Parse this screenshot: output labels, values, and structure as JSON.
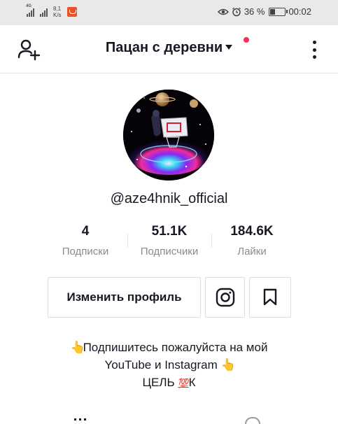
{
  "status_bar": {
    "signal1_tag": "4G",
    "net_speed_value": "8,1",
    "net_speed_unit": "K/s",
    "battery_percent": "36 %",
    "battery_level": 0.36,
    "time": "00:02"
  },
  "header": {
    "title": "Пацан с деревни",
    "notification_color": "#fe2c55"
  },
  "profile": {
    "username": "@aze4hnik_official",
    "avatar_icon": "space-basketball-hoop-avatar"
  },
  "stats": [
    {
      "value": "4",
      "label": "Подписки"
    },
    {
      "value": "51.1K",
      "label": "Подписчики"
    },
    {
      "value": "184.6K",
      "label": "Лайки"
    }
  ],
  "actions": {
    "edit_profile": "Изменить профиль",
    "instagram_icon": "instagram-icon",
    "bookmark_icon": "bookmark-icon"
  },
  "bio": {
    "line1_emoji": "👆",
    "line1": "Подпишитесь пожалуйста на мой",
    "line2": "YouTube и Instagram",
    "line2_emoji": "👆",
    "line3_prefix": "ЦЕЛЬ",
    "line3_emoji": "💯",
    "line3_suffix": "К"
  },
  "colors": {
    "accent": "#fe2c55",
    "text_primary": "#161823",
    "text_secondary": "#8a8b91"
  }
}
